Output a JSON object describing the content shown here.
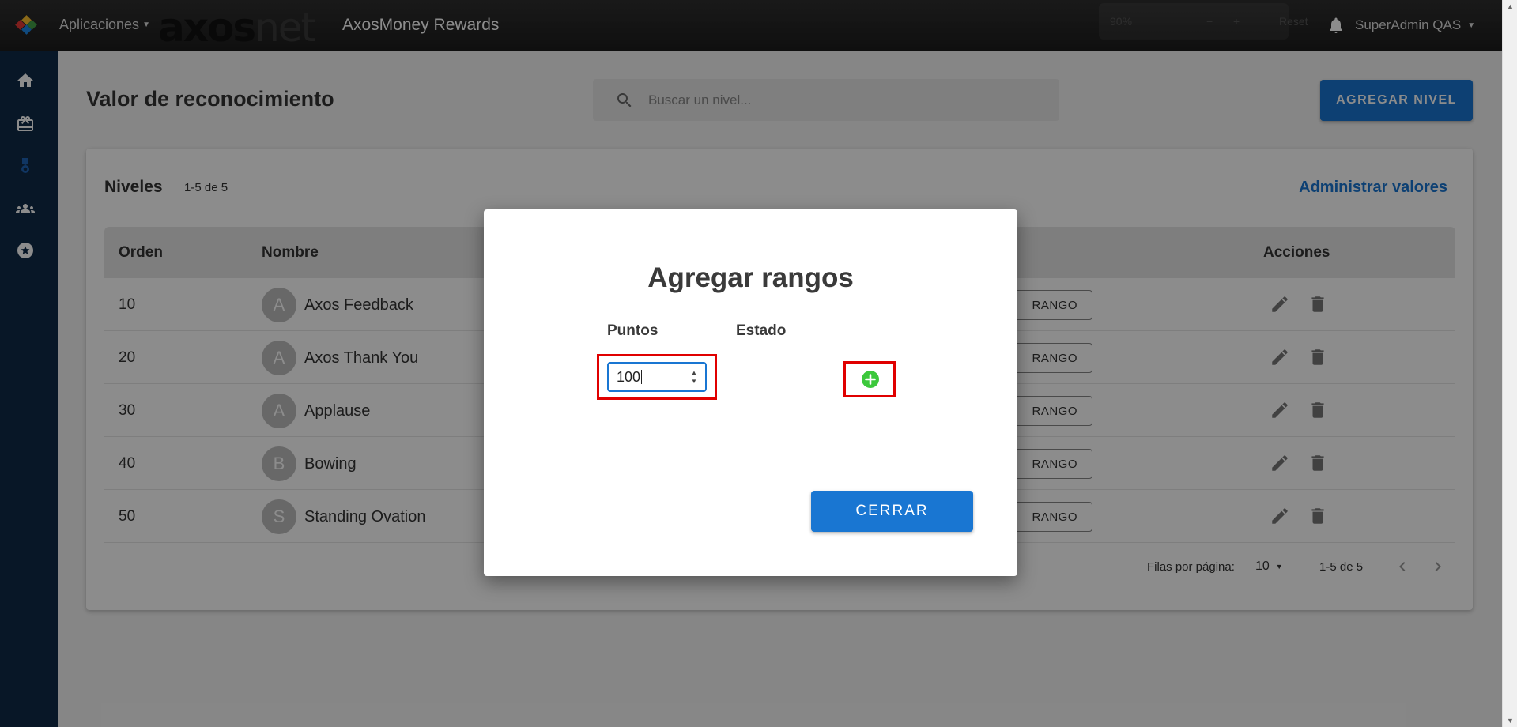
{
  "topbar": {
    "apps_label": "Aplicaciones",
    "brand_left": "axos",
    "brand_right": "net",
    "product_title": "AxosMoney Rewards",
    "zoom_value": "90%",
    "zoom_reset": "Reset",
    "user_name": "SuperAdmin QAS"
  },
  "sidebar": {
    "items": [
      {
        "icon": "home-icon"
      },
      {
        "icon": "gift-card-icon"
      },
      {
        "icon": "medal-icon"
      },
      {
        "icon": "users-icon"
      },
      {
        "icon": "star-circle-icon"
      }
    ]
  },
  "page": {
    "title": "Valor de reconocimiento",
    "search_placeholder": "Buscar un nivel...",
    "add_level_label": "AGREGAR NIVEL"
  },
  "levels": {
    "title": "Niveles",
    "count": "1-5 de 5",
    "manage_label": "Administrar valores",
    "columns": {
      "order": "Orden",
      "name": "Nombre",
      "actions": "Acciones"
    },
    "range_button_label": "RANGO",
    "rows": [
      {
        "order": "10",
        "initial": "A",
        "name": "Axos Feedback"
      },
      {
        "order": "20",
        "initial": "A",
        "name": "Axos Thank You"
      },
      {
        "order": "30",
        "initial": "A",
        "name": "Applause"
      },
      {
        "order": "40",
        "initial": "B",
        "name": "Bowing"
      },
      {
        "order": "50",
        "initial": "S",
        "name": "Standing Ovation"
      }
    ],
    "pagination": {
      "rows_per_page_label": "Filas por página:",
      "rows_per_page_value": "10",
      "page_info": "1-5 de 5"
    }
  },
  "modal": {
    "title": "Agregar rangos",
    "points_label": "Puntos",
    "status_label": "Estado",
    "points_value": "100",
    "close_label": "CERRAR"
  },
  "colors": {
    "primary": "#1976d2",
    "sidebar": "#0f2a47",
    "highlight": "#e00000",
    "add_icon": "#3cc83c"
  }
}
